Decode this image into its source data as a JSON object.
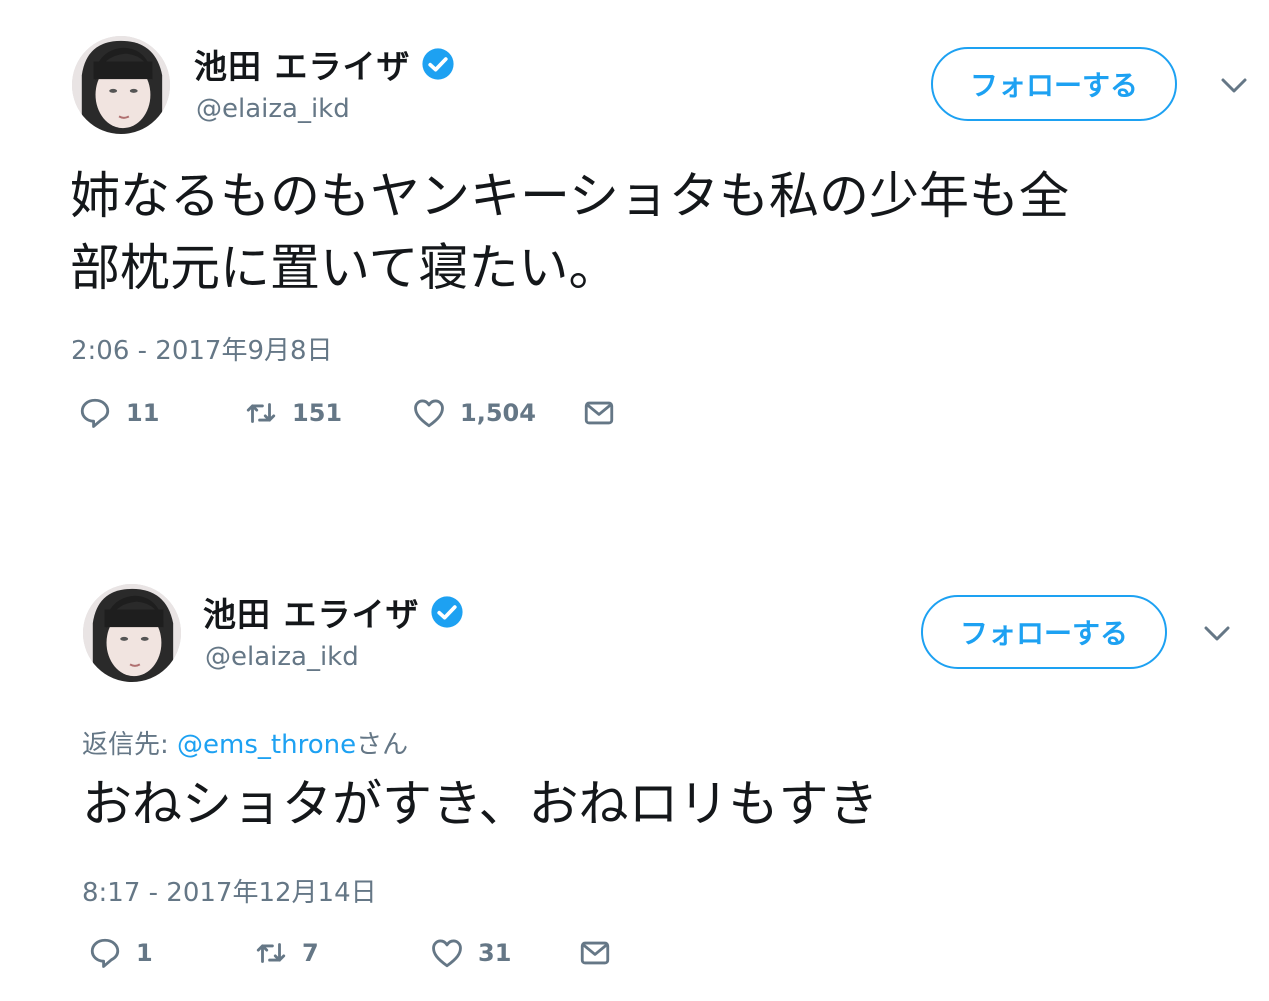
{
  "colors": {
    "accent": "#1da1f2",
    "secondary_text": "#657786",
    "primary_text": "#14171a"
  },
  "tweets": [
    {
      "display_name": "池田 エライザ",
      "handle": "@elaiza_ikd",
      "follow_label": "フォローする",
      "text_line1": "姉なるものもヤンキーショタも私の少年も全",
      "text_line2": "部枕元に置いて寝たい。",
      "timestamp": "2:06 - 2017年9月8日",
      "replies": "11",
      "retweets": "151",
      "likes": "1,504"
    },
    {
      "display_name": "池田 エライザ",
      "handle": "@elaiza_ikd",
      "follow_label": "フォローする",
      "reply_prefix": "返信先: ",
      "reply_mention": "@ems_throne",
      "reply_suffix": "さん",
      "text_line1": "おねショタがすき、おねロリもすき",
      "timestamp": "8:17 - 2017年12月14日",
      "replies": "1",
      "retweets": "7",
      "likes": "31"
    }
  ]
}
